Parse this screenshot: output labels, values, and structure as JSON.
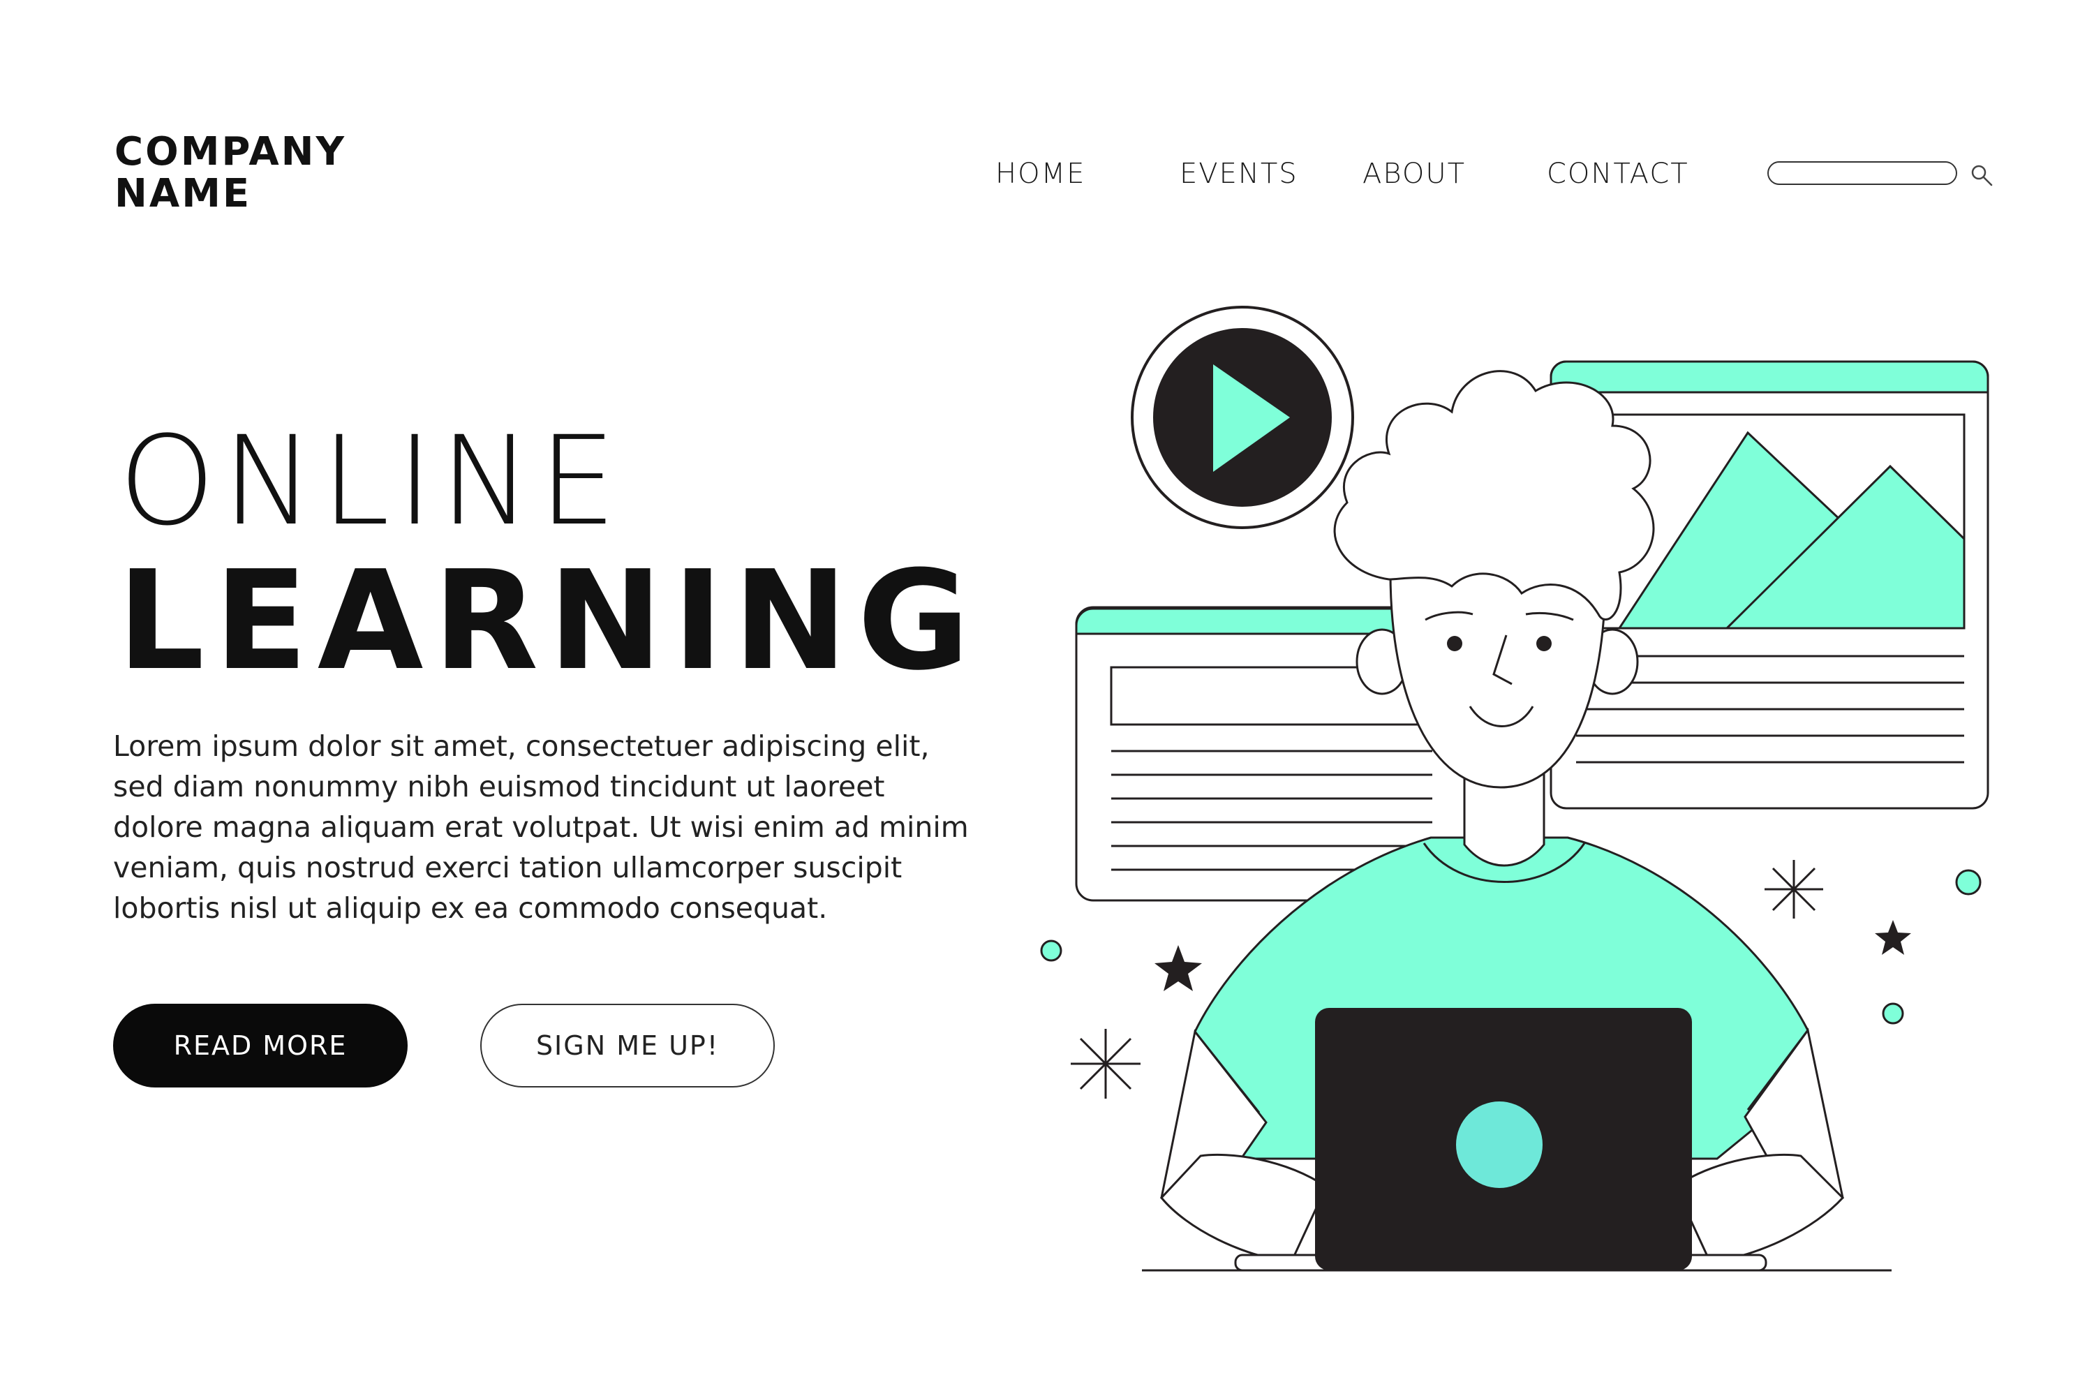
{
  "brand": {
    "line1": "COMPANY",
    "line2": "NAME"
  },
  "nav": {
    "items": [
      {
        "label": "HOME"
      },
      {
        "label": "EVENTS"
      },
      {
        "label": "ABOUT"
      },
      {
        "label": "CONTACT"
      }
    ]
  },
  "search": {
    "value": "",
    "placeholder": "",
    "icon": "search-icon"
  },
  "hero": {
    "title_line1": "ONLINE",
    "title_line2": "LEARNING",
    "body": "Lorem ipsum dolor sit amet, consectetuer adipiscing elit, sed diam nonummy nibh euismod tincidunt ut laoreet dolore magna aliquam erat volutpat. Ut wisi enim ad minim veniam, quis nostrud exerci tation ullamcorper suscipit lobortis nisl ut aliquip ex ea commodo consequat.",
    "buttons": {
      "read_more": "READ MORE",
      "sign_up": "SIGN ME UP!"
    }
  },
  "colors": {
    "accent": "#7fffd9",
    "dark": "#231f20",
    "laptop_dot": "#6ee8d9",
    "background": "#ffffff"
  },
  "icons": [
    "search-icon",
    "play-icon",
    "image-icon",
    "star-icon",
    "sparkle-icon"
  ]
}
